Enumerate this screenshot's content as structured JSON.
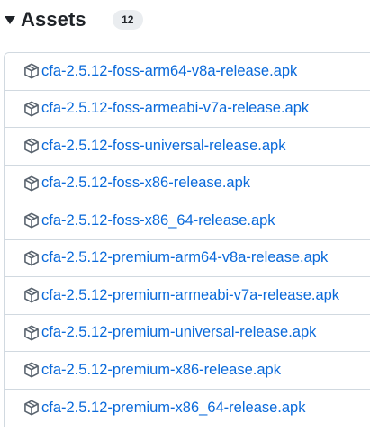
{
  "header": {
    "title": "Assets",
    "count": "12",
    "toggle_icon": "triangle-down-icon"
  },
  "colors": {
    "link": "#0969da",
    "border": "#d1d9e0",
    "counter_bg": "#eaedf0",
    "text": "#1f2328",
    "icon": "#59636e"
  },
  "assets": [
    {
      "name": "cfa-2.5.12-foss-arm64-v8a-release.apk",
      "icon": "package-icon"
    },
    {
      "name": "cfa-2.5.12-foss-armeabi-v7a-release.apk",
      "icon": "package-icon"
    },
    {
      "name": "cfa-2.5.12-foss-universal-release.apk",
      "icon": "package-icon"
    },
    {
      "name": "cfa-2.5.12-foss-x86-release.apk",
      "icon": "package-icon"
    },
    {
      "name": "cfa-2.5.12-foss-x86_64-release.apk",
      "icon": "package-icon"
    },
    {
      "name": "cfa-2.5.12-premium-arm64-v8a-release.apk",
      "icon": "package-icon"
    },
    {
      "name": "cfa-2.5.12-premium-armeabi-v7a-release.apk",
      "icon": "package-icon"
    },
    {
      "name": "cfa-2.5.12-premium-universal-release.apk",
      "icon": "package-icon"
    },
    {
      "name": "cfa-2.5.12-premium-x86-release.apk",
      "icon": "package-icon"
    },
    {
      "name": "cfa-2.5.12-premium-x86_64-release.apk",
      "icon": "package-icon"
    }
  ]
}
